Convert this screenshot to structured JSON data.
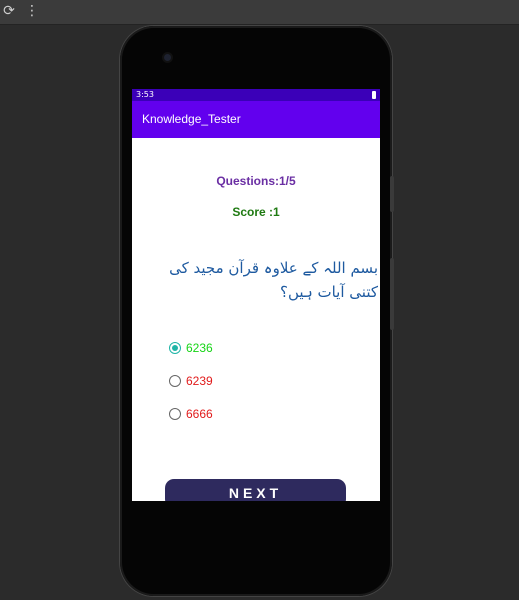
{
  "app": {
    "title": "Knowledge_Tester"
  },
  "status_bar": {
    "time": "3:53"
  },
  "quiz": {
    "question_counter": "Questions:1/5",
    "score": "Score :1",
    "question_text": "بسم اللہ کے علاوہ قرآن مجید کی کتنی آیات ہیں؟",
    "options": [
      {
        "label": "6236",
        "selected": true,
        "color": "#16d416"
      },
      {
        "label": "6239",
        "selected": false,
        "color": "#e11b1b"
      },
      {
        "label": "6666",
        "selected": false,
        "color": "#e11b1b"
      }
    ]
  },
  "next_button": {
    "label": "NEXT"
  },
  "colors": {
    "primary": "#6200ee",
    "status_bar": "#3b00b8",
    "question_counter": "#6a2ea3",
    "score": "#1f7a12",
    "question": "#1e5aa0",
    "next_button": "#2e2a5e",
    "radio_checked": "#1fb5a7"
  }
}
